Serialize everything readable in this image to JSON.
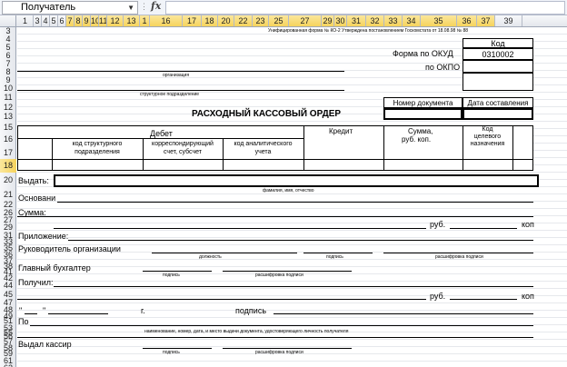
{
  "formula_bar": {
    "name_box": "Получатель",
    "fx_label": "fx"
  },
  "columns": [
    "1",
    "3",
    "4",
    "5",
    "6",
    "7",
    "8",
    "9",
    "10",
    "11",
    "12",
    "13",
    "1",
    "16",
    "17",
    "18",
    "20",
    "22",
    "23",
    "25",
    "27",
    "29",
    "30",
    "31",
    "32",
    "33",
    "34",
    "35",
    "36",
    "37",
    "39"
  ],
  "rows": [
    "3",
    "4",
    "5",
    "6",
    "7",
    "8",
    "9",
    "10",
    "11",
    "12",
    "13",
    "15",
    "16",
    "17",
    "18",
    "20",
    "21",
    "22",
    "26",
    "27",
    "29",
    "31",
    "33",
    "35",
    "36",
    "37",
    "38",
    "41",
    "42",
    "44",
    "45",
    "47",
    "48",
    "49",
    "51",
    "53",
    "55",
    "56",
    "57",
    "58",
    "59",
    "61",
    "62"
  ],
  "form": {
    "header_note": "Унифицированная форма № КО-2 Утверждена постановлением Госкомстата от 18.08.98 № 88",
    "kod": "Код",
    "forma_okud_label": "Форма по ОКУД",
    "forma_okud_value": "0310002",
    "okpo_label": "по ОКПО",
    "organizatsiya": "организация",
    "strukturnoe": "структурное подразделение",
    "nomer_dokumenta": "Номер документа",
    "data_sostavleniya": "Дата составления",
    "title": "РАСХОДНЫЙ КАССОВЫЙ ОРДЕР",
    "debet": "Дебет",
    "kredit": "Кредит",
    "summa_l1": "Сумма,",
    "summa_l2": "руб. коп.",
    "kod_cel_l1": "Код",
    "kod_cel_l2": "целевого",
    "kod_cel_l3": "назначения",
    "kod_strukt_l1": "код структурного",
    "kod_strukt_l2": "подразделения",
    "korr_l1": "корреспондирующий",
    "korr_l2": "счет, субсчет",
    "kod_analit_l1": "код аналитического",
    "kod_analit_l2": "учета",
    "vydat": "Выдать:",
    "fio": "фамилия, имя, отчество",
    "osnovanie": "Основани",
    "summa": "Сумма:",
    "rub": "руб.",
    "kop": "коп",
    "prilozhenie": "Приложение:",
    "rukovoditel": "Руководитель организации",
    "dolzhnost": "должность",
    "podpis": "подпись",
    "rasshifrovka": "расшифровка подписи",
    "glavbuh": "Главный бухгалтер",
    "poluchil": "Получил:",
    "quote": "\"",
    "g": "г.",
    "po": "По",
    "naimenovanie": "наименование, номер, дата, и место выдачи документа, удостоверяющего личность получателя",
    "vydal_kassir": "Выдал кассир"
  }
}
